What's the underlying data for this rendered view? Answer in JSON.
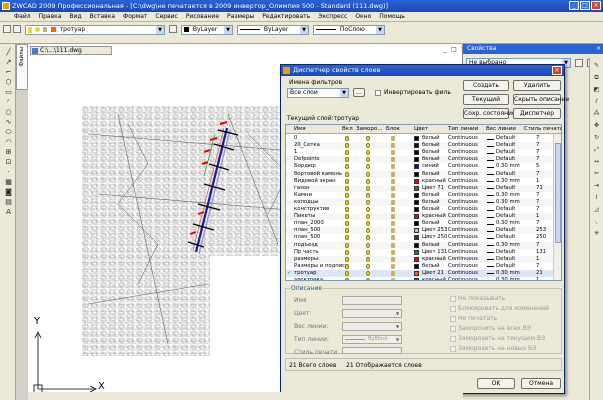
{
  "window": {
    "title": "ZWCAD 2009 Профессиональная - [C:\\dwg\\не печатается в 2009 инвертор_Олимпия 500 - Standard (111.dwg)]",
    "controls": [
      "_",
      "□",
      "×"
    ]
  },
  "menu": [
    "Файл",
    "Правка",
    "Вид",
    "Вставка",
    "Формат",
    "Сервис",
    "Рисование",
    "Размеры",
    "Редактировать",
    "Экспресс",
    "Окно",
    "Помощь"
  ],
  "layer_toolbar": {
    "current_layer": "тротуар",
    "color": "ByLayer",
    "linetype": "ByLayer",
    "lineweight": "ПоСлою"
  },
  "file_tab_label": "Файлы",
  "document_tab": "C:\\...\\111.dwg",
  "properties_palette": {
    "title": "Свойства",
    "selection": "Не выбрано"
  },
  "dialog": {
    "title": "Диспетчер свойств слоев",
    "filters_label": "Имена фильтров",
    "filter_value": "Все слои",
    "filter_btn": "...",
    "invert_label": "Инвертировать филь",
    "current_layer_label": "Текущий слой:тротуар",
    "buttons": {
      "new": "Создать",
      "delete": "Удалить",
      "current": "Текущий",
      "hide_desc": "Скрыть описание",
      "save_state": "Сохр. состояние",
      "manager": "Диспетчер",
      "ok": "OK",
      "cancel": "Отмена"
    },
    "columns": [
      "Имя",
      "Вкл",
      "Заморо...",
      "Блок",
      "Цвет",
      "Тип линии",
      "Вес линии",
      "Стиль печати"
    ],
    "layers": [
      {
        "name": "0",
        "color": "белый",
        "sw": "#000000",
        "linetype": "Continuous",
        "lw": "Default",
        "style": "7"
      },
      {
        "name": "20_Сетка",
        "color": "белый",
        "sw": "#000000",
        "linetype": "Continuous",
        "lw": "Default",
        "style": "7"
      },
      {
        "name": "1",
        "color": "белый",
        "sw": "#000000",
        "linetype": "Continuous",
        "lw": "Default",
        "style": "7"
      },
      {
        "name": "Defpoints",
        "color": "белый",
        "sw": "#000000",
        "linetype": "Continuous",
        "lw": "Default",
        "style": "7"
      },
      {
        "name": "Бордюр",
        "color": "синий",
        "sw": "#0000ff",
        "linetype": "Continuous",
        "lw": "0.30 mm",
        "style": "5"
      },
      {
        "name": "бортовой камень",
        "color": "белый",
        "sw": "#000000",
        "linetype": "Continuous",
        "lw": "Default",
        "style": "7"
      },
      {
        "name": "Видовой экран",
        "color": "красный",
        "sw": "#ff0000",
        "linetype": "Continuous",
        "lw": "0.30 mm",
        "style": "1"
      },
      {
        "name": "газон",
        "color": "Цвет 71",
        "sw": "#3c7a1c",
        "linetype": "Continuous",
        "lw": "Default",
        "style": "71"
      },
      {
        "name": "Камни",
        "color": "белый",
        "sw": "#000000",
        "linetype": "Continuous",
        "lw": "0.30 mm",
        "style": "7"
      },
      {
        "name": "колодцы",
        "color": "белый",
        "sw": "#000000",
        "linetype": "Continuous",
        "lw": "0.30 mm",
        "style": "7"
      },
      {
        "name": "конструктив",
        "color": "белый",
        "sw": "#000000",
        "linetype": "Continuous",
        "lw": "Default",
        "style": "7"
      },
      {
        "name": "Пикеты",
        "color": "красный",
        "sw": "#ff0000",
        "linetype": "Continuous",
        "lw": "Default",
        "style": "1"
      },
      {
        "name": "план_2000",
        "color": "белый",
        "sw": "#000000",
        "linetype": "Continuous",
        "lw": "0.30 mm",
        "style": "7"
      },
      {
        "name": "план_500",
        "color": "Цвет 253",
        "sw": "#c0c0c0",
        "linetype": "Continuous",
        "lw": "Default",
        "style": "253"
      },
      {
        "name": "план_500",
        "color": "Цвет 250",
        "sw": "#333333",
        "linetype": "Continuous",
        "lw": "Default",
        "style": "250"
      },
      {
        "name": "подъезд",
        "color": "белый",
        "sw": "#000000",
        "linetype": "Continuous",
        "lw": "0.30 mm",
        "style": "7"
      },
      {
        "name": "Пр часть",
        "color": "Цвет 131",
        "sw": "#007fbf",
        "linetype": "Continuous",
        "lw": "Default",
        "style": "131"
      },
      {
        "name": "размеры",
        "color": "красный",
        "sw": "#ff0000",
        "linetype": "Continuous",
        "lw": "Default",
        "style": "1"
      },
      {
        "name": "Размеры и подписи",
        "color": "белый",
        "sw": "#000000",
        "linetype": "Continuous",
        "lw": "Default",
        "style": "7"
      },
      {
        "name": "тротуар",
        "color": "Цвет 21",
        "sw": "#ff5f00",
        "linetype": "Continuous",
        "lw": "0.30 mm",
        "style": "21"
      },
      {
        "name": "электрика",
        "color": "красный",
        "sw": "#ff0000",
        "linetype": "Continuous",
        "lw": "0.30 mm",
        "style": "1"
      }
    ],
    "description": {
      "group_label": "Описание",
      "name_label": "Имя",
      "color_label": "Цвет:",
      "lineweight_label": "Вес линии:",
      "linetype_label": "Тип линии:",
      "linetype_value": "ByBlock",
      "plotstyle_label": "Стиль печати",
      "options": [
        "Не показывать",
        "Блокировать для изменений",
        "Не печатать",
        "Заморозить на всех ВЭ",
        "Заморозить на текущем ВЭ",
        "Заморозить на новых ВЭ"
      ]
    },
    "status": {
      "total": "21 Всего слоев",
      "shown": "21 Отображается слоев"
    }
  },
  "ucs": {
    "x": "X",
    "y": "Y"
  }
}
